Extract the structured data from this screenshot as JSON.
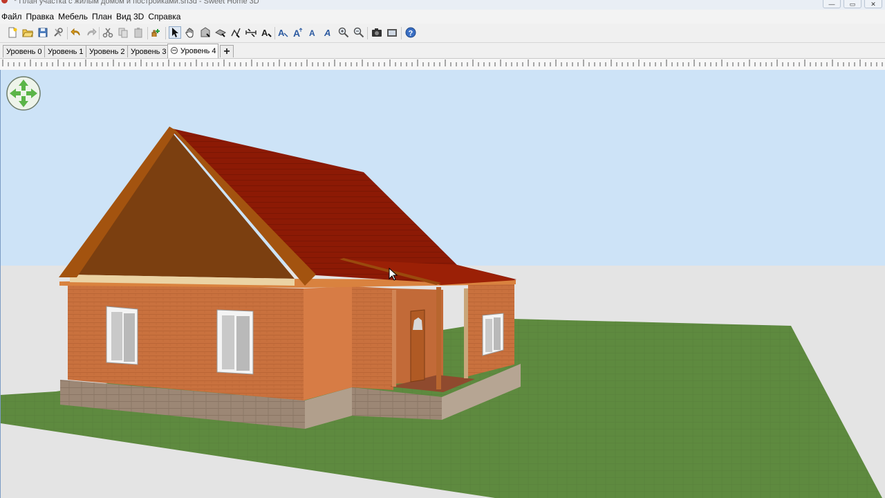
{
  "window": {
    "title": "* План участка с жилым домом и постройками.sh3d - Sweet Home 3D",
    "controls": [
      "—",
      "▭",
      "✕"
    ]
  },
  "menu": [
    "Файл",
    "Правка",
    "Мебель",
    "План",
    "Вид 3D",
    "Справка"
  ],
  "toolbar": {
    "buttons": [
      "new-home-icon",
      "open-icon",
      "save-icon",
      "preferences-icon",
      "undo-icon",
      "redo-icon",
      "cut-icon",
      "copy-icon",
      "paste-icon",
      "add-furniture-icon",
      "select-mode-icon",
      "pan-icon",
      "create-walls-icon",
      "create-rooms-icon",
      "create-polylines-icon",
      "create-dimensions-icon",
      "add-text-icon",
      "modify-text-style-icon",
      "increase-text-size-icon",
      "decrease-text-size-icon",
      "bold-text-icon",
      "italic-text-icon",
      "zoom-in-icon",
      "zoom-out-icon",
      "create-photo-icon",
      "create-video-icon",
      "help-icon"
    ],
    "selected_mode": "select-mode-icon"
  },
  "levels": {
    "tabs": [
      "Уровень 0",
      "Уровень 1",
      "Уровень 2",
      "Уровень 3",
      "Уровень 4"
    ],
    "selected": "Уровень 4",
    "add_label": "+"
  },
  "view3d": {
    "colors": {
      "sky": "#cde3f7",
      "ground": "#e4e4e4",
      "grass": "#5e8a3f",
      "brick": "#c9713e",
      "roof": "#8c1a05",
      "timber": "#a3530f",
      "foundation": "#9c8775"
    }
  }
}
